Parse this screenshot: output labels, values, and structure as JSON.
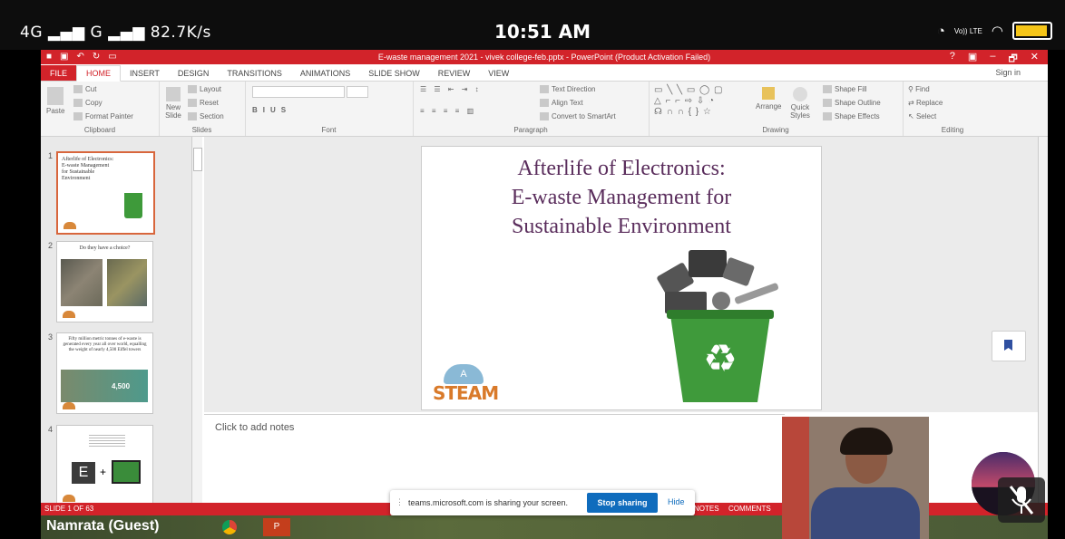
{
  "status_bar": {
    "network": "4G",
    "network2": "G",
    "speed": "82.7K/s",
    "time": "10:51 AM",
    "volte": "Vo)) LTE",
    "battery_level": 0.85
  },
  "powerpoint": {
    "title": "E-waste management 2021 - vivek college-feb.pptx - PowerPoint (Product Activation Failed)",
    "window_controls": [
      "?",
      "▣",
      "–",
      "🗗",
      "✕"
    ],
    "tabs": [
      "FILE",
      "HOME",
      "INSERT",
      "DESIGN",
      "TRANSITIONS",
      "ANIMATIONS",
      "SLIDE SHOW",
      "REVIEW",
      "VIEW"
    ],
    "active_tab": "HOME",
    "sign_in": "Sign in",
    "ribbon": {
      "clipboard": {
        "paste": "Paste",
        "cut": "Cut",
        "copy": "Copy",
        "format_painter": "Format Painter",
        "label": "Clipboard"
      },
      "slides": {
        "new_slide": "New Slide",
        "layout": "Layout",
        "reset": "Reset",
        "section": "Section",
        "label": "Slides"
      },
      "font": {
        "label": "Font"
      },
      "paragraph": {
        "text_direction": "Text Direction",
        "align_text": "Align Text",
        "convert": "Convert to SmartArt",
        "label": "Paragraph"
      },
      "drawing": {
        "arrange": "Arrange",
        "quick_styles": "Quick Styles",
        "shape_fill": "Shape Fill",
        "shape_outline": "Shape Outline",
        "shape_effects": "Shape Effects",
        "label": "Drawing"
      },
      "editing": {
        "find": "Find",
        "replace": "Replace",
        "select": "Select",
        "label": "Editing"
      }
    },
    "thumbnails": [
      {
        "num": "1",
        "text": "Afterlife of Electronics: E-waste Management for Sustainable Environment"
      },
      {
        "num": "2",
        "text": "Do they have a choice?"
      },
      {
        "num": "3",
        "text": "Fifty million metric tonnes of e-waste is generated every year all over world, equalling the weight of nearly 4,500 Eiffel towers",
        "badge": "4,500"
      },
      {
        "num": "4",
        "text": ""
      }
    ],
    "slide": {
      "title_lines": [
        "Afterlife of Electronics:",
        "E-waste Management for",
        "Sustainable Environment"
      ],
      "logo_text": "STEAM",
      "logo_letter": "A"
    },
    "notes_placeholder": "Click to add notes",
    "status": {
      "slide_count": "SLIDE 1 OF 63",
      "notes": "NOTES",
      "comments": "COMMENTS"
    },
    "taskbar_user": "Namrata (Guest)"
  },
  "teams_share": {
    "message": "teams.microsoft.com is sharing your screen.",
    "stop_label": "Stop sharing",
    "hide_label": "Hide"
  },
  "colors": {
    "ppt_red": "#d2232a",
    "title_purple": "#5a2d5c",
    "teams_blue": "#0f6cbd"
  }
}
